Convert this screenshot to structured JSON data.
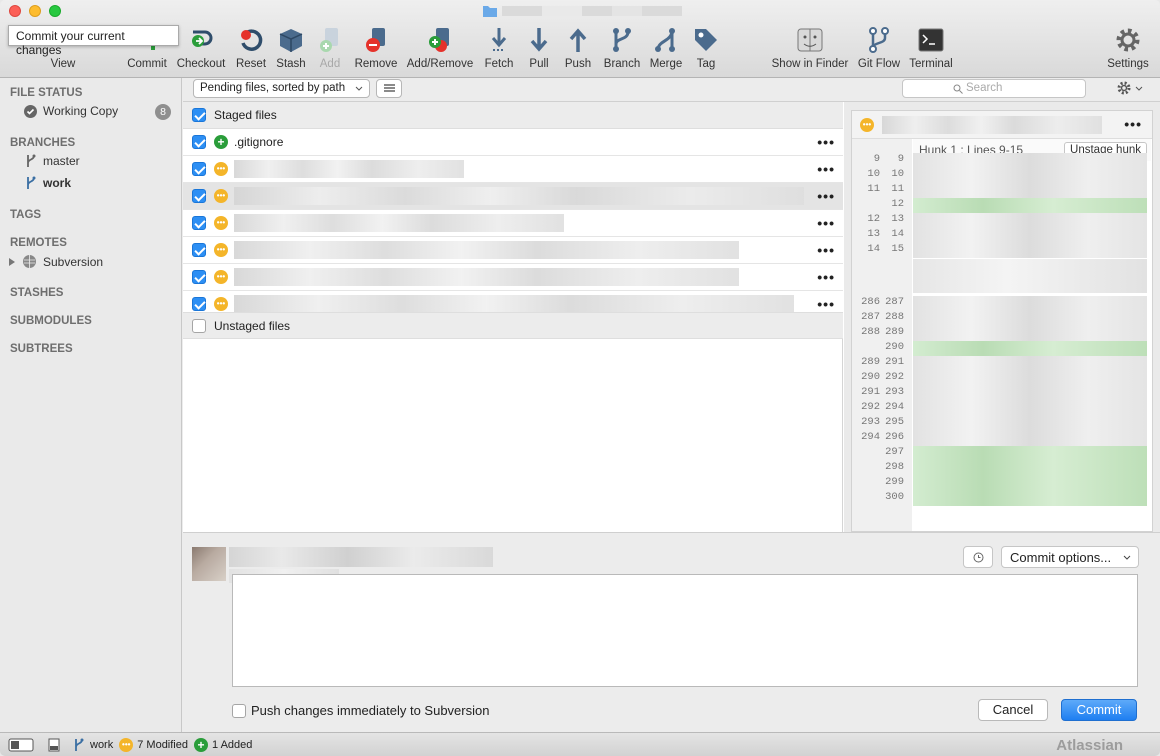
{
  "tooltip": "Commit your current changes",
  "toolbar": {
    "view": "View",
    "commit": "Commit",
    "checkout": "Checkout",
    "reset": "Reset",
    "stash": "Stash",
    "add": "Add",
    "remove": "Remove",
    "add_remove": "Add/Remove",
    "fetch": "Fetch",
    "pull": "Pull",
    "push": "Push",
    "branch": "Branch",
    "merge": "Merge",
    "tag": "Tag",
    "show_in_finder": "Show in Finder",
    "git_flow": "Git Flow",
    "terminal": "Terminal",
    "settings": "Settings"
  },
  "sidebar": {
    "file_status": "FILE STATUS",
    "working_copy": "Working Copy",
    "working_copy_count": "8",
    "branches": "BRANCHES",
    "branch_master": "master",
    "branch_work": "work",
    "tags": "TAGS",
    "remotes": "REMOTES",
    "remote_subversion": "Subversion",
    "stashes": "STASHES",
    "submodules": "SUBMODULES",
    "subtrees": "SUBTREES"
  },
  "filter": {
    "sort": "Pending files, sorted by path",
    "search_placeholder": "Search"
  },
  "staged": {
    "header": "Staged files",
    "first_file": ".gitignore",
    "more": "•••"
  },
  "unstaged": {
    "header": "Unstaged files"
  },
  "diff": {
    "hunk_title": "Hunk 1 : Lines 9-15",
    "unstage_hunk": "Unstage hunk",
    "more": "•••",
    "lines": [
      {
        "old": "9",
        "new": "9"
      },
      {
        "old": "10",
        "new": "10"
      },
      {
        "old": "11",
        "new": "11"
      },
      {
        "old": "",
        "new": "12"
      },
      {
        "old": "12",
        "new": "13"
      },
      {
        "old": "13",
        "new": "14"
      },
      {
        "old": "14",
        "new": "15"
      },
      {
        "old": "286",
        "new": "287"
      },
      {
        "old": "287",
        "new": "288"
      },
      {
        "old": "288",
        "new": "289"
      },
      {
        "old": "",
        "new": "290"
      },
      {
        "old": "289",
        "new": "291"
      },
      {
        "old": "290",
        "new": "292"
      },
      {
        "old": "291",
        "new": "293"
      },
      {
        "old": "292",
        "new": "294"
      },
      {
        "old": "293",
        "new": "295"
      },
      {
        "old": "294",
        "new": "296"
      },
      {
        "old": "",
        "new": "297"
      },
      {
        "old": "",
        "new": "298"
      },
      {
        "old": "",
        "new": "299"
      },
      {
        "old": "",
        "new": "300"
      }
    ]
  },
  "composer": {
    "commit_options": "Commit options...",
    "push_label": "Push changes immediately to Subversion",
    "cancel": "Cancel",
    "commit": "Commit"
  },
  "status": {
    "branch": "work",
    "modified": "7 Modified",
    "added": "1 Added",
    "brand": "Atlassian"
  },
  "colors": {
    "accent": "#2d8ff4",
    "added": "#2a9d3a",
    "modified": "#f4b52a",
    "diff_added_bg": "#d9f0d3"
  }
}
